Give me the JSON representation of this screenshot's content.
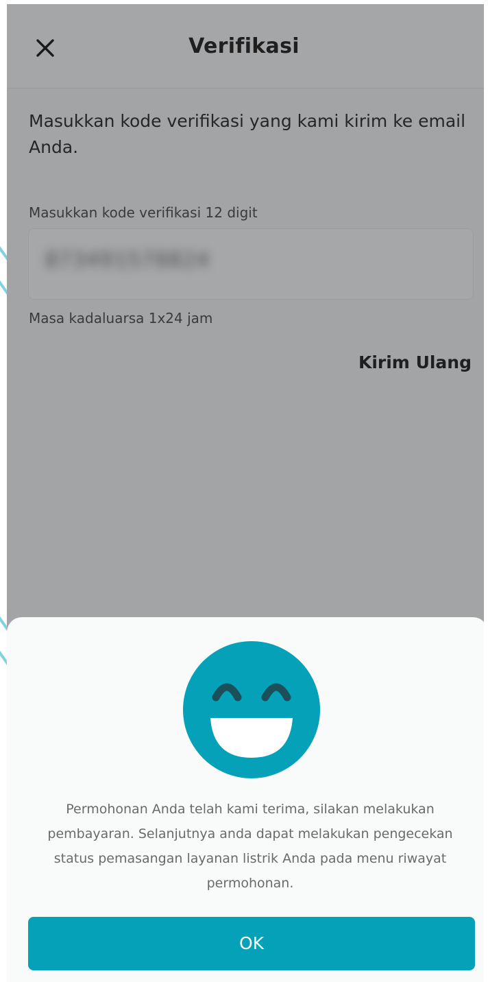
{
  "header": {
    "title": "Verifikasi",
    "close_icon": "close-icon"
  },
  "main": {
    "instruction": "Masukkan kode verifikasi yang kami kirim ke email Anda.",
    "code_field": {
      "label": "Masukkan kode verifikasi 12 digit",
      "value": "873491570824"
    },
    "expiry_note": "Masa kadaluarsa 1x24 jam",
    "resend_label": "Kirim Ulang"
  },
  "dialog": {
    "icon": "smiley-face-icon",
    "message": "Permohonan Anda telah kami terima, silakan melakukan pembayaran. Selanjutnya anda dapat melakukan pengecekan status pemasangan layanan listrik Anda pada menu riwayat permohonan.",
    "ok_label": "OK"
  },
  "colors": {
    "accent": "#05a1b9",
    "overlay": "#a3a4a6",
    "sheet_background": "#f9fafa"
  }
}
